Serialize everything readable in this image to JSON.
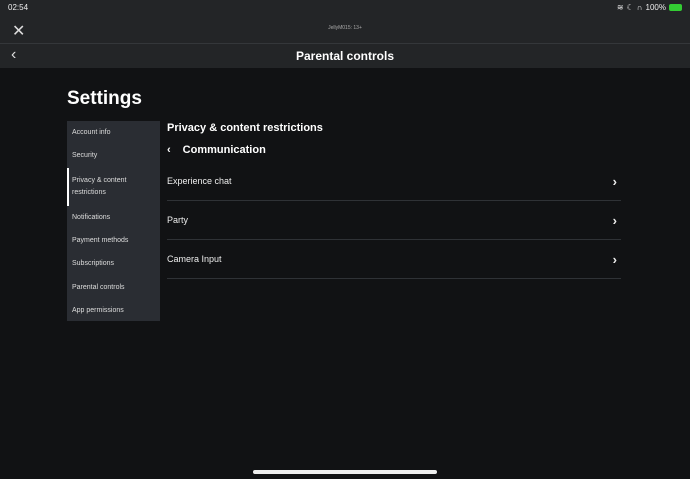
{
  "status": {
    "time": "02:54",
    "battery": "100%"
  },
  "header": {
    "user": "JellyM015: 13+",
    "title": "Parental controls"
  },
  "page_title": "Settings",
  "sidebar": {
    "items": [
      {
        "label": "Account info"
      },
      {
        "label": "Security"
      },
      {
        "label": "Privacy & content restrictions"
      },
      {
        "label": "Notifications"
      },
      {
        "label": "Payment methods"
      },
      {
        "label": "Subscriptions"
      },
      {
        "label": "Parental controls"
      },
      {
        "label": "App permissions"
      }
    ]
  },
  "main": {
    "section": "Privacy & content restrictions",
    "subsection": "Communication",
    "rows": [
      {
        "label": "Experience chat"
      },
      {
        "label": "Party"
      },
      {
        "label": "Camera Input"
      }
    ]
  }
}
